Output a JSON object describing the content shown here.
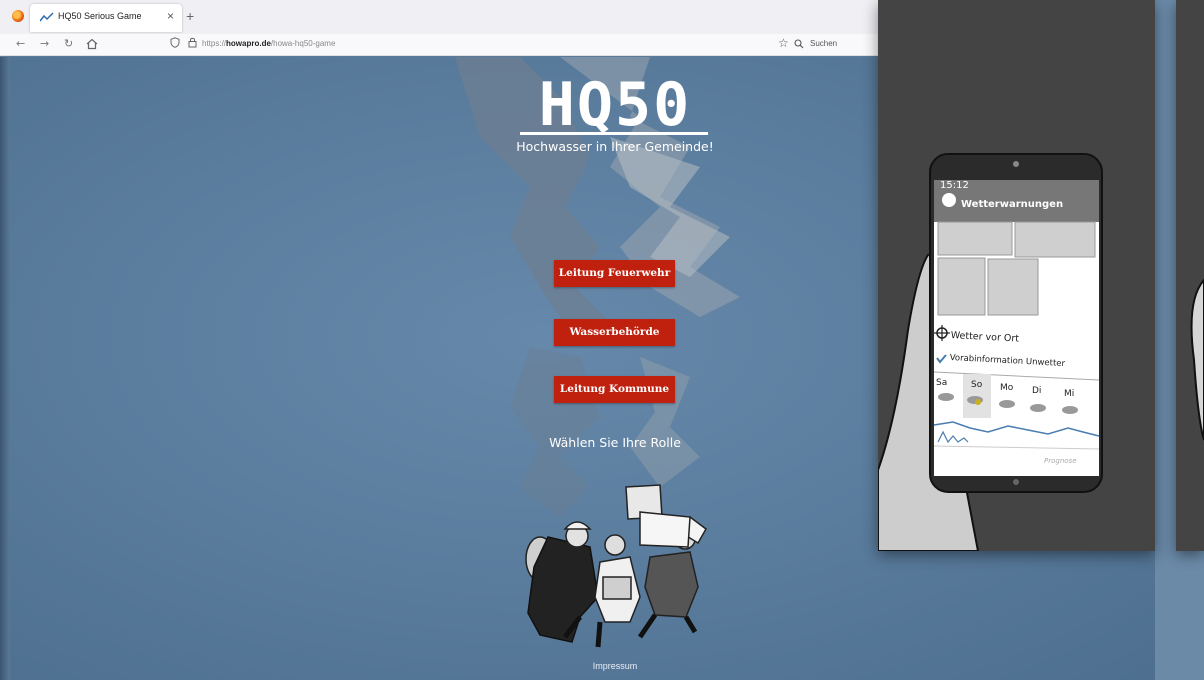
{
  "browser": {
    "tab_title": "HQ50 Serious Game",
    "tab_close": "×",
    "new_tab": "+",
    "url_prefix": "https://",
    "url_domain": "howapro.de",
    "url_path": "/howa-hq50-game",
    "search_placeholder": "Suchen"
  },
  "game": {
    "title": "HQ50",
    "subtitle": "Hochwasser in Ihrer Gemeinde!",
    "roles": [
      "Leitung Feuerwehr",
      "Wasserbehörde",
      "Leitung Kommune"
    ],
    "choose_role": "Wählen Sie Ihre Rolle",
    "footer_link": "Impressum"
  },
  "phone": {
    "time": "15:12",
    "app_title": "Wetterwarnungen",
    "local_weather": "Wetter vor Ort",
    "pre_warning": "Vorabinformation Unwetter",
    "days": [
      "Sa",
      "So",
      "Mo",
      "Di",
      "Mi"
    ],
    "forecast_label": "Prognose"
  },
  "colors": {
    "page_bg": "#5b7d9e",
    "button_red": "#c0210f",
    "panel_dark": "#444444"
  }
}
